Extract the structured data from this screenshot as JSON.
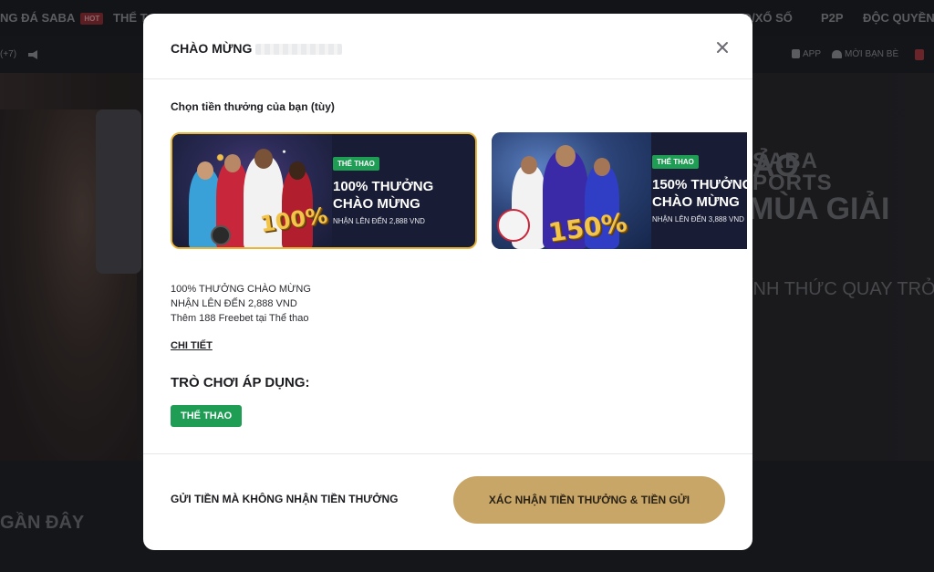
{
  "background": {
    "nav": {
      "items": [
        {
          "label": "NG ĐÁ SABA",
          "badge": "HOT"
        },
        {
          "label": "THỂ T"
        },
        {
          "label": "O/XỔ SỐ"
        },
        {
          "label": "P2P"
        },
        {
          "label": "ĐỘC QUYỀN"
        }
      ]
    },
    "subnav": {
      "timezone": "(+7)",
      "app_label": "APP",
      "invite_label": "MỜI BẠN BÈ"
    },
    "hero": {
      "brand_line1": "SABA",
      "brand_line2": "PORTS",
      "headline1": "ẢO",
      "headline2": "MÙA GIẢI",
      "subtext": "ÍNH THỨC QUAY TRỞ L"
    },
    "recent_heading": "GẦN ĐÂY"
  },
  "modal": {
    "title": "CHÀO MỪNG",
    "choose_label": "Chọn tiền thưởng của bạn (tùy)",
    "cards": [
      {
        "tag": "THỂ THAO",
        "headline_line1": "100% THƯỞNG",
        "headline_line2": "CHÀO MỪNG",
        "sub": "NHẬN LÊN ĐẾN 2,888 VND",
        "art_percent": "100%",
        "selected": true
      },
      {
        "tag": "THỂ THAO",
        "headline_line1": "150% THƯỞNG",
        "headline_line2": "CHÀO MỪNG",
        "sub": "NHẬN LÊN ĐẾN 3,888 VND",
        "art_percent": "150%",
        "selected": false
      }
    ],
    "description": {
      "line1": "100% THƯỞNG CHÀO MỪNG",
      "line2": "NHẬN LÊN ĐẾN 2,888 VND",
      "line3": "Thêm 188 Freebet tại Thể thao"
    },
    "detail_link": "CHI TIẾT",
    "games_title": "TRÒ CHƠI ÁP DỤNG:",
    "games_tag": "THỂ THAO",
    "skip_button": "GỬI TIỀN MÀ KHÔNG NHẬN TIỀN THƯỞNG",
    "confirm_button": "XÁC NHẬN TIỀN THƯỞNG & TIỀN GỬI"
  },
  "colors": {
    "accent_gold": "#c8a667",
    "selected_border": "#e8b53b",
    "tag_green": "#1f9d55"
  }
}
